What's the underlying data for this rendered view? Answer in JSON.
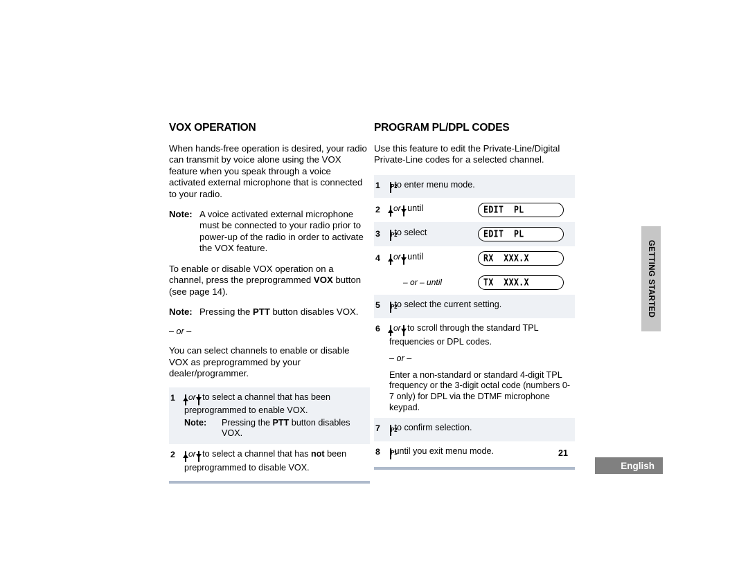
{
  "page": {
    "number": "21",
    "language": "English",
    "side_tab": "GETTING STARTED"
  },
  "left_column": {
    "title": "VOX OPERATION",
    "intro": "When hands-free operation is desired, your radio can transmit by voice alone using the VOX feature when you speak through a voice activated external microphone that is connected to your radio.",
    "note1_label": "Note:",
    "note1_text": "A voice activated external microphone must be connected to your radio prior to power-up of the radio in order to activate the VOX feature.",
    "para2_a": "To enable or disable VOX operation on a channel, press the preprogrammed ",
    "para2_bold": "VOX",
    "para2_b": " button (see page 14).",
    "note2_label": "Note:",
    "note2_a": "Pressing the ",
    "note2_bold": "PTT",
    "note2_b": " button disables VOX.",
    "or_separator": "– or –",
    "para3": "You can select channels to enable or disable VOX as preprogrammed by your dealer/programmer.",
    "steps": [
      {
        "num": "1",
        "or_label": "or",
        "text_a": " to select a channel that has been preprogrammed to enable VOX.",
        "note_label": "Note:",
        "note_a": "Pressing the ",
        "note_bold": "PTT",
        "note_b": " button disables VOX."
      },
      {
        "num": "2",
        "or_label": "or",
        "text_a": " to select a channel that has ",
        "text_bold": "not",
        "text_b": " been preprogrammed to disable VOX."
      }
    ]
  },
  "right_column": {
    "title": "PROGRAM PL/DPL CODES",
    "intro": "Use this feature to edit the Private-Line/Digital Private-Line codes for a selected channel.",
    "steps": [
      {
        "num": "1",
        "button": "P2",
        "text": " to enter menu mode."
      },
      {
        "num": "2",
        "or_label": "or",
        "text": " until",
        "lcd": "EDIT  PL"
      },
      {
        "num": "3",
        "button": "P2",
        "text": " to select",
        "lcd": "EDIT  PL"
      },
      {
        "num": "4",
        "or_label": "or",
        "text": " until",
        "lcd": "RX  XXX.X"
      },
      {
        "num": "",
        "or_until": "– or – until",
        "lcd": "TX  XXX.X"
      },
      {
        "num": "5",
        "button": "P2",
        "text": " to select the current setting."
      },
      {
        "num": "6",
        "or_label": "or",
        "text": " to scroll through the standard TPL frequencies or DPL codes.",
        "or_separator": "– or –",
        "extra": "Enter a non-standard or standard 4-digit TPL frequency or the 3-digit octal code (numbers 0-7 only) for DPL via the DTMF microphone keypad."
      },
      {
        "num": "7",
        "button": "P2",
        "text": " to confirm selection."
      },
      {
        "num": "8",
        "button": "P1",
        "text": " until you exit menu mode."
      }
    ]
  },
  "colors": {
    "row_shade": "#eef1f5",
    "rule": "#aebacb",
    "side_tab_bg": "#c6c6c6",
    "lang_bg": "#808080"
  }
}
